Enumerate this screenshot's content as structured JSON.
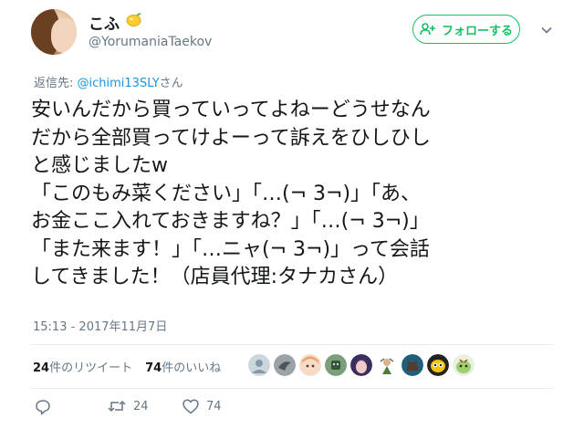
{
  "user": {
    "display_name": "こふ",
    "screen_name": "@YorumaniaTaekov",
    "name_emoji_icon": "lemon-icon"
  },
  "follow_button": {
    "label": "フォローする",
    "icon": "follow-user-icon",
    "color": "#17bf63"
  },
  "menu": {
    "icon": "chevron-down-icon"
  },
  "reply_to": {
    "prefix": "返信先: ",
    "mention": "@ichimi13SLY",
    "suffix": "さん"
  },
  "tweet": {
    "lines": [
      "安いんだから買っていってよねーどうせなん",
      "だから全部買ってけよーって訴えをひしひし",
      "と感じましたw",
      "「このもみ菜ください」「…(¬ 3¬)」「あ、",
      "お金ここ入れておきますね？」「…(¬ 3¬)」",
      "「また来ます！」「…ニャ(¬ 3¬)」って会話",
      "してきました！（店員代理:タナカさん）"
    ]
  },
  "timestamp": "15:13 - 2017年11月7日",
  "stats": {
    "retweet_count": "24",
    "retweet_label": "件のリツイート",
    "like_count": "74",
    "like_label": "件のいいね"
  },
  "likers": [
    {
      "icon": "default-avatar-icon"
    },
    {
      "icon": "bird-avatar-icon"
    },
    {
      "icon": "anime-avatar-icon"
    },
    {
      "icon": "robot-avatar-icon"
    },
    {
      "icon": "anime-avatar-icon"
    },
    {
      "icon": "character-avatar-icon"
    },
    {
      "icon": "cat-avatar-icon"
    },
    {
      "icon": "bee-avatar-icon"
    },
    {
      "icon": "character-avatar-icon"
    }
  ],
  "actions": {
    "reply_icon": "reply-icon",
    "retweet_icon": "retweet-icon",
    "retweet_count": "24",
    "like_icon": "heart-icon",
    "like_count": "74"
  },
  "colors": {
    "text": "#14171a",
    "secondary": "#657786",
    "link": "#1b95e0",
    "divider": "#e6ecf0",
    "follow_green": "#17bf63"
  }
}
